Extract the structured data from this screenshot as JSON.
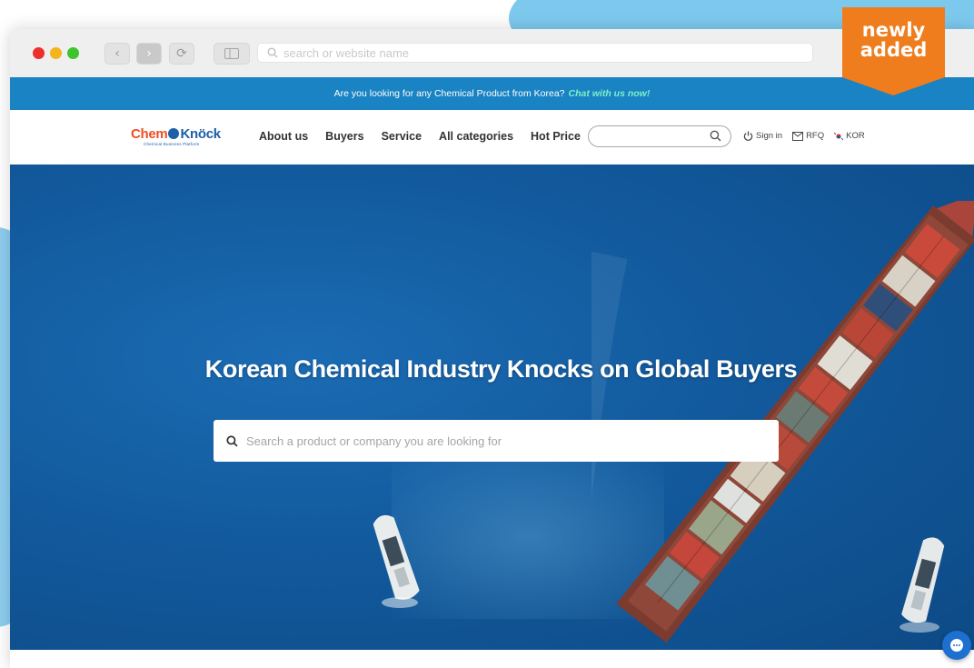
{
  "browser": {
    "address_placeholder": "search or website name"
  },
  "badge": {
    "line1": "newly",
    "line2": "added",
    "color": "#ef7d1d"
  },
  "announce": {
    "text": "Are you looking for any Chemical Product from Korea?",
    "link": "Chat with us now!"
  },
  "header": {
    "logo_chem": "Chem",
    "logo_knock": "Knöck",
    "logo_tagline": "Chemical Business Platform",
    "menu": [
      "About us",
      "Buyers",
      "Service",
      "All categories",
      "Hot Price"
    ],
    "tools": {
      "sign_in": "Sign in",
      "rfq": "RFQ",
      "lang": "KOR"
    }
  },
  "hero": {
    "title": "Korean Chemical Industry Knocks on Global Buyers",
    "search_placeholder": "Search a product or company you are looking for"
  },
  "colors": {
    "announce_bg": "#1a83c3",
    "chat_link": "#7ff0c8",
    "logo_orange": "#f04e23",
    "logo_blue": "#1a5fa8"
  }
}
